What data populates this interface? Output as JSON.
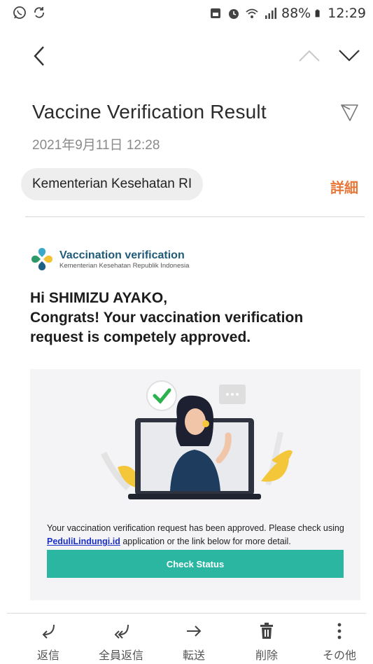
{
  "status_bar": {
    "battery": "88%",
    "time": "12:29"
  },
  "email": {
    "subject": "Vaccine Verification Result",
    "date": "2021年9月11日  12:28",
    "sender": "Kementerian Kesehatan RI",
    "details_label": "詳細"
  },
  "body": {
    "brand_title": "Vaccination verification",
    "brand_subtitle": "Kementerian Kesehatan Republik Indonesia",
    "greeting_line1": "Hi SHIMIZU AYAKO,",
    "greeting_line2": "Congrats! Your vaccination verification request is competely approved.",
    "card_text_before": "Your vaccination verification request has been approved. Please check using ",
    "card_link": "PeduliLindungi.id",
    "card_text_after": " application or the link below for more detail.",
    "button_label": "Check Status"
  },
  "actions": [
    {
      "label": "返信",
      "icon": "reply-icon"
    },
    {
      "label": "全員返信",
      "icon": "reply-all-icon"
    },
    {
      "label": "転送",
      "icon": "forward-icon"
    },
    {
      "label": "削除",
      "icon": "trash-icon"
    },
    {
      "label": "その他",
      "icon": "more-vertical-icon"
    }
  ],
  "colors": {
    "accent": "#e8773a",
    "button": "#2bb6a2",
    "brand": "#1f5a78",
    "link": "#1a2fc7"
  }
}
